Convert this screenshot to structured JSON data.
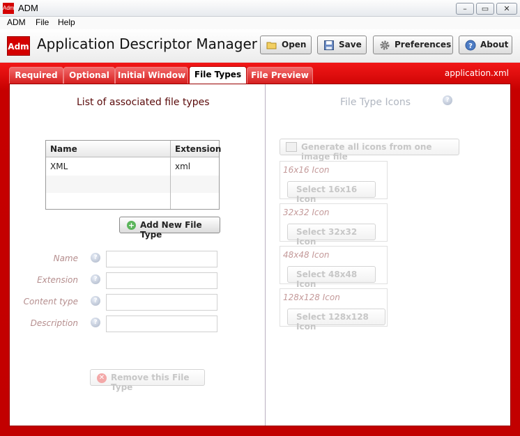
{
  "window": {
    "title": "ADM",
    "icon_text": "Adm"
  },
  "menu": [
    "ADM",
    "File",
    "Help"
  ],
  "header": {
    "logo_text": "Adm",
    "title": "Application Descriptor Manager",
    "buttons": {
      "open": "Open",
      "save": "Save",
      "preferences": "Preferences",
      "about": "About"
    }
  },
  "tabs": [
    "Required",
    "Optional",
    "Initial Window",
    "File Types",
    "File Preview"
  ],
  "active_tab": "File Types",
  "descriptor_file": "application.xml",
  "left": {
    "title": "List of associated file types",
    "table": {
      "columns": [
        "Name",
        "Extension"
      ],
      "rows": [
        {
          "name": "XML",
          "extension": "xml"
        }
      ]
    },
    "add_button": "Add New File Type",
    "fields": {
      "name": "Name",
      "extension": "Extension",
      "content_type": "Content type",
      "description": "Description"
    },
    "remove_button": "Remove this File Type"
  },
  "right": {
    "title": "File Type Icons",
    "generate_button": "Generate all icons from one image file",
    "icons": [
      {
        "caption": "16x16 Icon",
        "button": "Select 16x16 Icon"
      },
      {
        "caption": "32x32 Icon",
        "button": "Select 32x32 Icon"
      },
      {
        "caption": "48x48 Icon",
        "button": "Select 48x48 Icon"
      },
      {
        "caption": "128x128 Icon",
        "button": "Select 128x128 Icon"
      }
    ]
  },
  "colors": {
    "frame_red": "#c60000",
    "tab_red": "#e23a3a",
    "logo_red": "#d40000"
  }
}
